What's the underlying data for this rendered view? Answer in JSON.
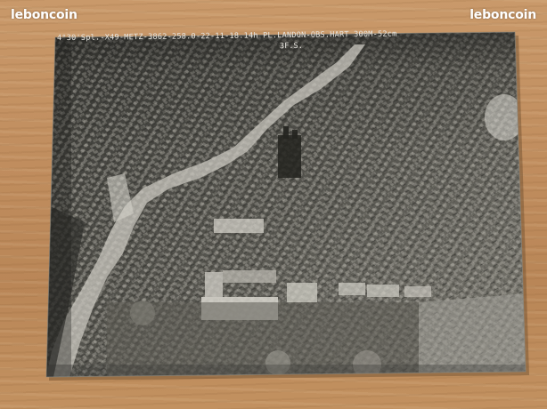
{
  "watermark": {
    "left": "leboncoin",
    "right": "leboncoin"
  },
  "photo": {
    "caption": "4°30'Spl.-X49-METZ-3862-258.0-22-11-18.14h PL.LANDON-OBS.HART 300M-52cm",
    "code": "3F.S."
  },
  "colors": {
    "table": "#c08d5e",
    "photo_dark": "#2f2f2c",
    "photo_light": "#c8c6be",
    "watermark": "#ffffff"
  }
}
